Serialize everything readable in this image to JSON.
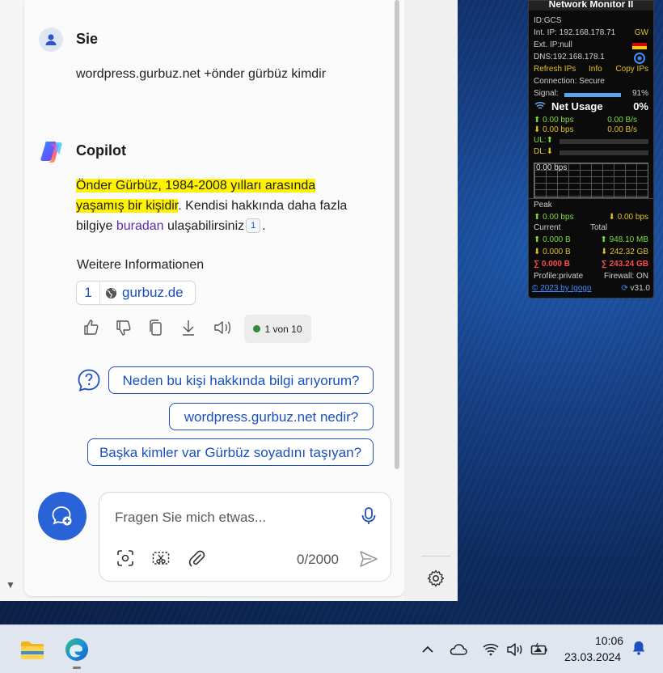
{
  "conversation": {
    "user": {
      "name": "Sie",
      "message": "wordpress.gurbuz.net +önder gürbüz kimdir"
    },
    "assistant": {
      "name": "Copilot",
      "answer_part1": "Önder Gürbüz, 1984-2008 yılları arasında",
      "answer_part2": "yaşamış bir kişidir",
      "answer_part3": ". Kendisi hakkında daha fazla",
      "answer_part4": "bilgiye ",
      "answer_link": "buradan",
      "answer_part5": " ulaşabilirsiniz",
      "citation": "1",
      "answer_end": ".",
      "more_info_heading": "Weitere Informationen",
      "source": {
        "num": "1",
        "label": "gurbuz.de"
      },
      "response_counter": "1 von 10"
    },
    "suggestions": [
      "Neden bu kişi hakkında bilgi arıyorum?",
      "wordpress.gurbuz.net nedir?",
      "Başka kimler var Gürbüz soyadını taşıyan?"
    ]
  },
  "composer": {
    "placeholder": "Fragen Sie mich etwas...",
    "char_count": "0/2000"
  },
  "network_monitor": {
    "title": "Network Monitor II",
    "id": "ID:GCS",
    "int_ip": "Int. IP: 192.168.178.71",
    "gw": "GW",
    "ext_ip": "Ext. IP:null",
    "dns": "DNS:192.168.178.1",
    "refresh": "Refresh IPs",
    "info": "Info",
    "copy": "Copy IPs",
    "connection": "Connection: Secure",
    "signal_label": "Signal:",
    "signal_value": "91%",
    "signal_fraction": 0.91,
    "net_usage_label": "Net Usage",
    "net_usage_value": "0%",
    "up_bps": "0.00 bps",
    "up_bs": "0.00 B/s",
    "down_bps": "0.00 bps",
    "down_bs": "0.00 B/s",
    "ul": "UL:",
    "dl": "DL:",
    "graph_label": "0.00 bps",
    "peak_label": "Peak",
    "peak_up": "0.00 bps",
    "peak_down": "0.00 bps",
    "current_label": "Current",
    "total_label": "Total",
    "current_up": "0.000 B",
    "total_up": "948.10 MB",
    "current_down": "0.000 B",
    "total_down": "242.32 GB",
    "sum_current": "0.000 B",
    "sum_total": "243.24 GB",
    "profile": "Profile:private",
    "firewall": "Firewall: ON",
    "copyright": "© 2023 by Igogo",
    "version": "v31.0"
  },
  "taskbar": {
    "time": "10:06",
    "date": "23.03.2024"
  }
}
